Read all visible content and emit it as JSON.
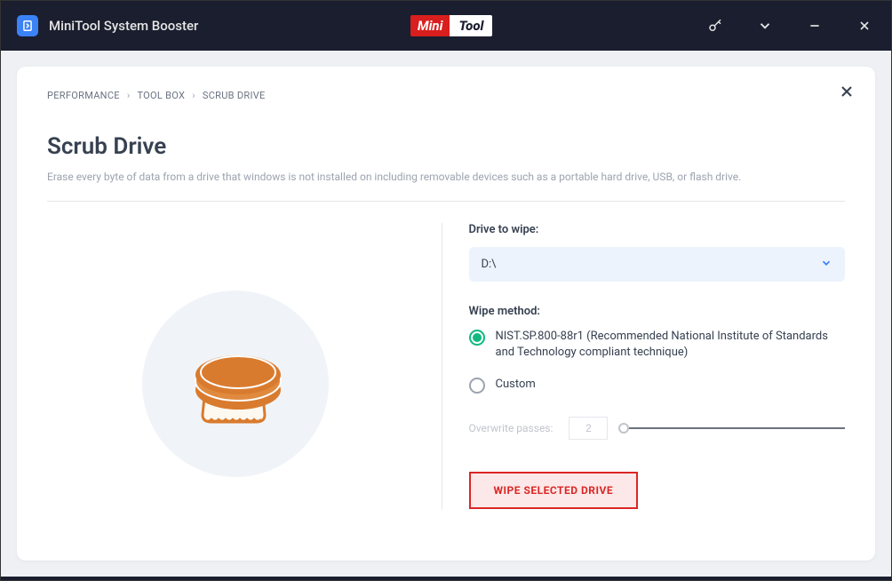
{
  "titlebar": {
    "app_title": "MiniTool System Booster",
    "logo_mini": "Mini",
    "logo_tool": "Tool"
  },
  "breadcrumb": {
    "items": [
      "PERFORMANCE",
      "TOOL BOX",
      "SCRUB DRIVE"
    ]
  },
  "page": {
    "title": "Scrub Drive",
    "description": "Erase every byte of data from a drive that windows is not installed on including removable devices such as a portable hard drive, USB, or flash drive."
  },
  "drive": {
    "label": "Drive to wipe:",
    "value": "D:\\"
  },
  "method": {
    "label": "Wipe method:",
    "options": [
      {
        "label": "NIST.SP.800-88r1 (Recommended National Institute of Standards and Technology compliant technique)",
        "selected": true
      },
      {
        "label": "Custom",
        "selected": false
      }
    ]
  },
  "passes": {
    "label": "Overwrite passes:",
    "value": "2"
  },
  "action": {
    "button_label": "WIPE SELECTED DRIVE"
  }
}
